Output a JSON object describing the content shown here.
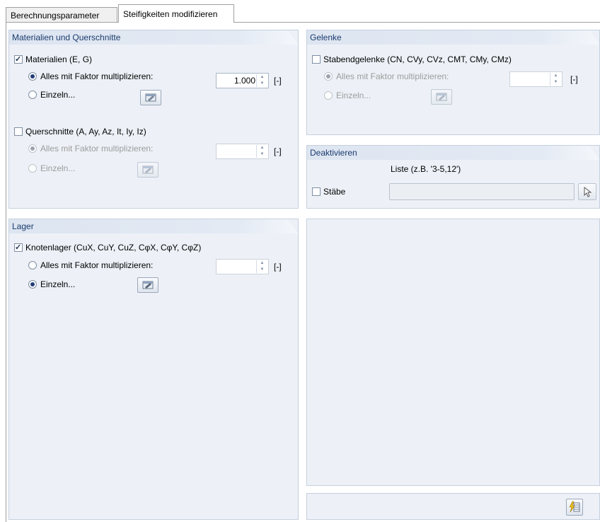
{
  "tabs": [
    {
      "label": "Berechnungsparameter"
    },
    {
      "label": "Steifigkeiten modifizieren"
    }
  ],
  "materials_panel": {
    "title": "Materialien und Querschnitte",
    "materials": {
      "label": "Materialien (E, G)",
      "checked": true,
      "multiply_label": "Alles mit Faktor multiplizieren:",
      "factor_value": "1.000",
      "unit": "[-]",
      "single_label": "Einzeln..."
    },
    "cross_sections": {
      "label": "Querschnitte (A, Ay, Az, It, Iy, Iz)",
      "checked": false,
      "multiply_label": "Alles mit Faktor multiplizieren:",
      "factor_value": "",
      "unit": "[-]",
      "single_label": "Einzeln..."
    }
  },
  "joints_panel": {
    "title": "Gelenke",
    "member_hinges": {
      "label": "Stabendgelenke (CN, CVy, CVz, CMT, CMy, CMz)",
      "checked": false,
      "multiply_label": "Alles mit Faktor multiplizieren:",
      "factor_value": "",
      "unit": "[-]",
      "single_label": "Einzeln..."
    }
  },
  "deactivate_panel": {
    "title": "Deaktivieren",
    "list_header": "Liste (z.B. '3-5,12')",
    "members_label": "Stäbe",
    "members_checked": false,
    "list_value": ""
  },
  "supports_panel": {
    "title": "Lager",
    "nodal_supports": {
      "label": "Knotenlager (CuX, CuY, CuZ, CφX, CφY, CφZ)",
      "checked": true,
      "multiply_label": "Alles mit Faktor multiplizieren:",
      "factor_value": "",
      "unit": "[-]",
      "single_label": "Einzeln..."
    }
  },
  "icons": {
    "edit": "edit-table-icon",
    "pick": "pick-from-graphic-icon",
    "calc": "lightning-table-icon"
  }
}
